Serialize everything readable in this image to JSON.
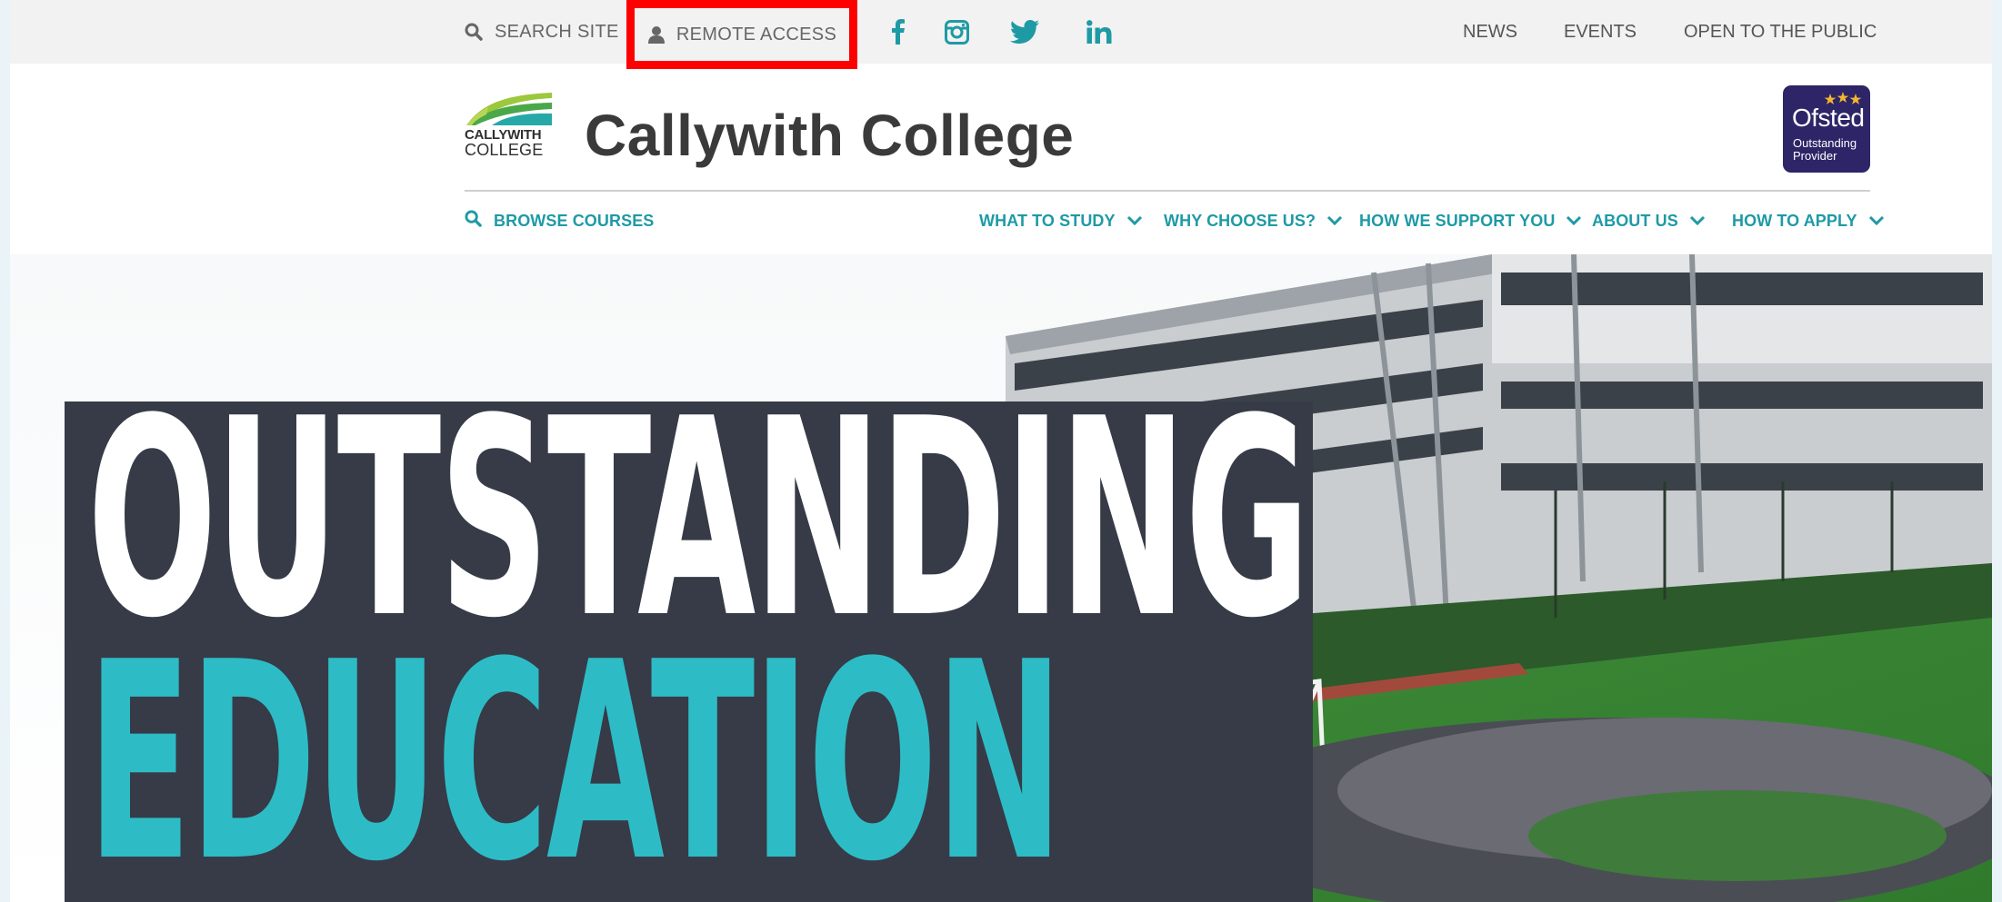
{
  "topbar": {
    "search_label": "SEARCH SITE",
    "remote_access_label": "REMOTE ACCESS",
    "social": [
      "facebook-icon",
      "instagram-icon",
      "twitter-icon",
      "linkedin-icon"
    ],
    "links": {
      "news": "NEWS",
      "events": "EVENTS",
      "open_to_public": "OPEN TO THE PUBLIC"
    }
  },
  "brand": {
    "logo_line1": "CALLYWITH",
    "logo_line2": "COLLEGE",
    "title": "Callywith College"
  },
  "ofsted": {
    "word": "Ofsted",
    "sub1": "Outstanding",
    "sub2": "Provider"
  },
  "nav": {
    "browse": "BROWSE COURSES",
    "items": [
      {
        "label": "WHAT TO STUDY"
      },
      {
        "label": "WHY CHOOSE US?"
      },
      {
        "label": "HOW WE SUPPORT YOU"
      },
      {
        "label": "ABOUT US"
      },
      {
        "label": "HOW TO APPLY"
      }
    ]
  },
  "hero": {
    "line1": "OUTSTANDING",
    "line2": "EDUCATION"
  },
  "colors": {
    "accent": "#1e9aa5",
    "hero_teal": "#2dbcc6",
    "hero_panel": "#363b47",
    "highlight": "#ff0000",
    "ofsted": "#2d2567"
  }
}
